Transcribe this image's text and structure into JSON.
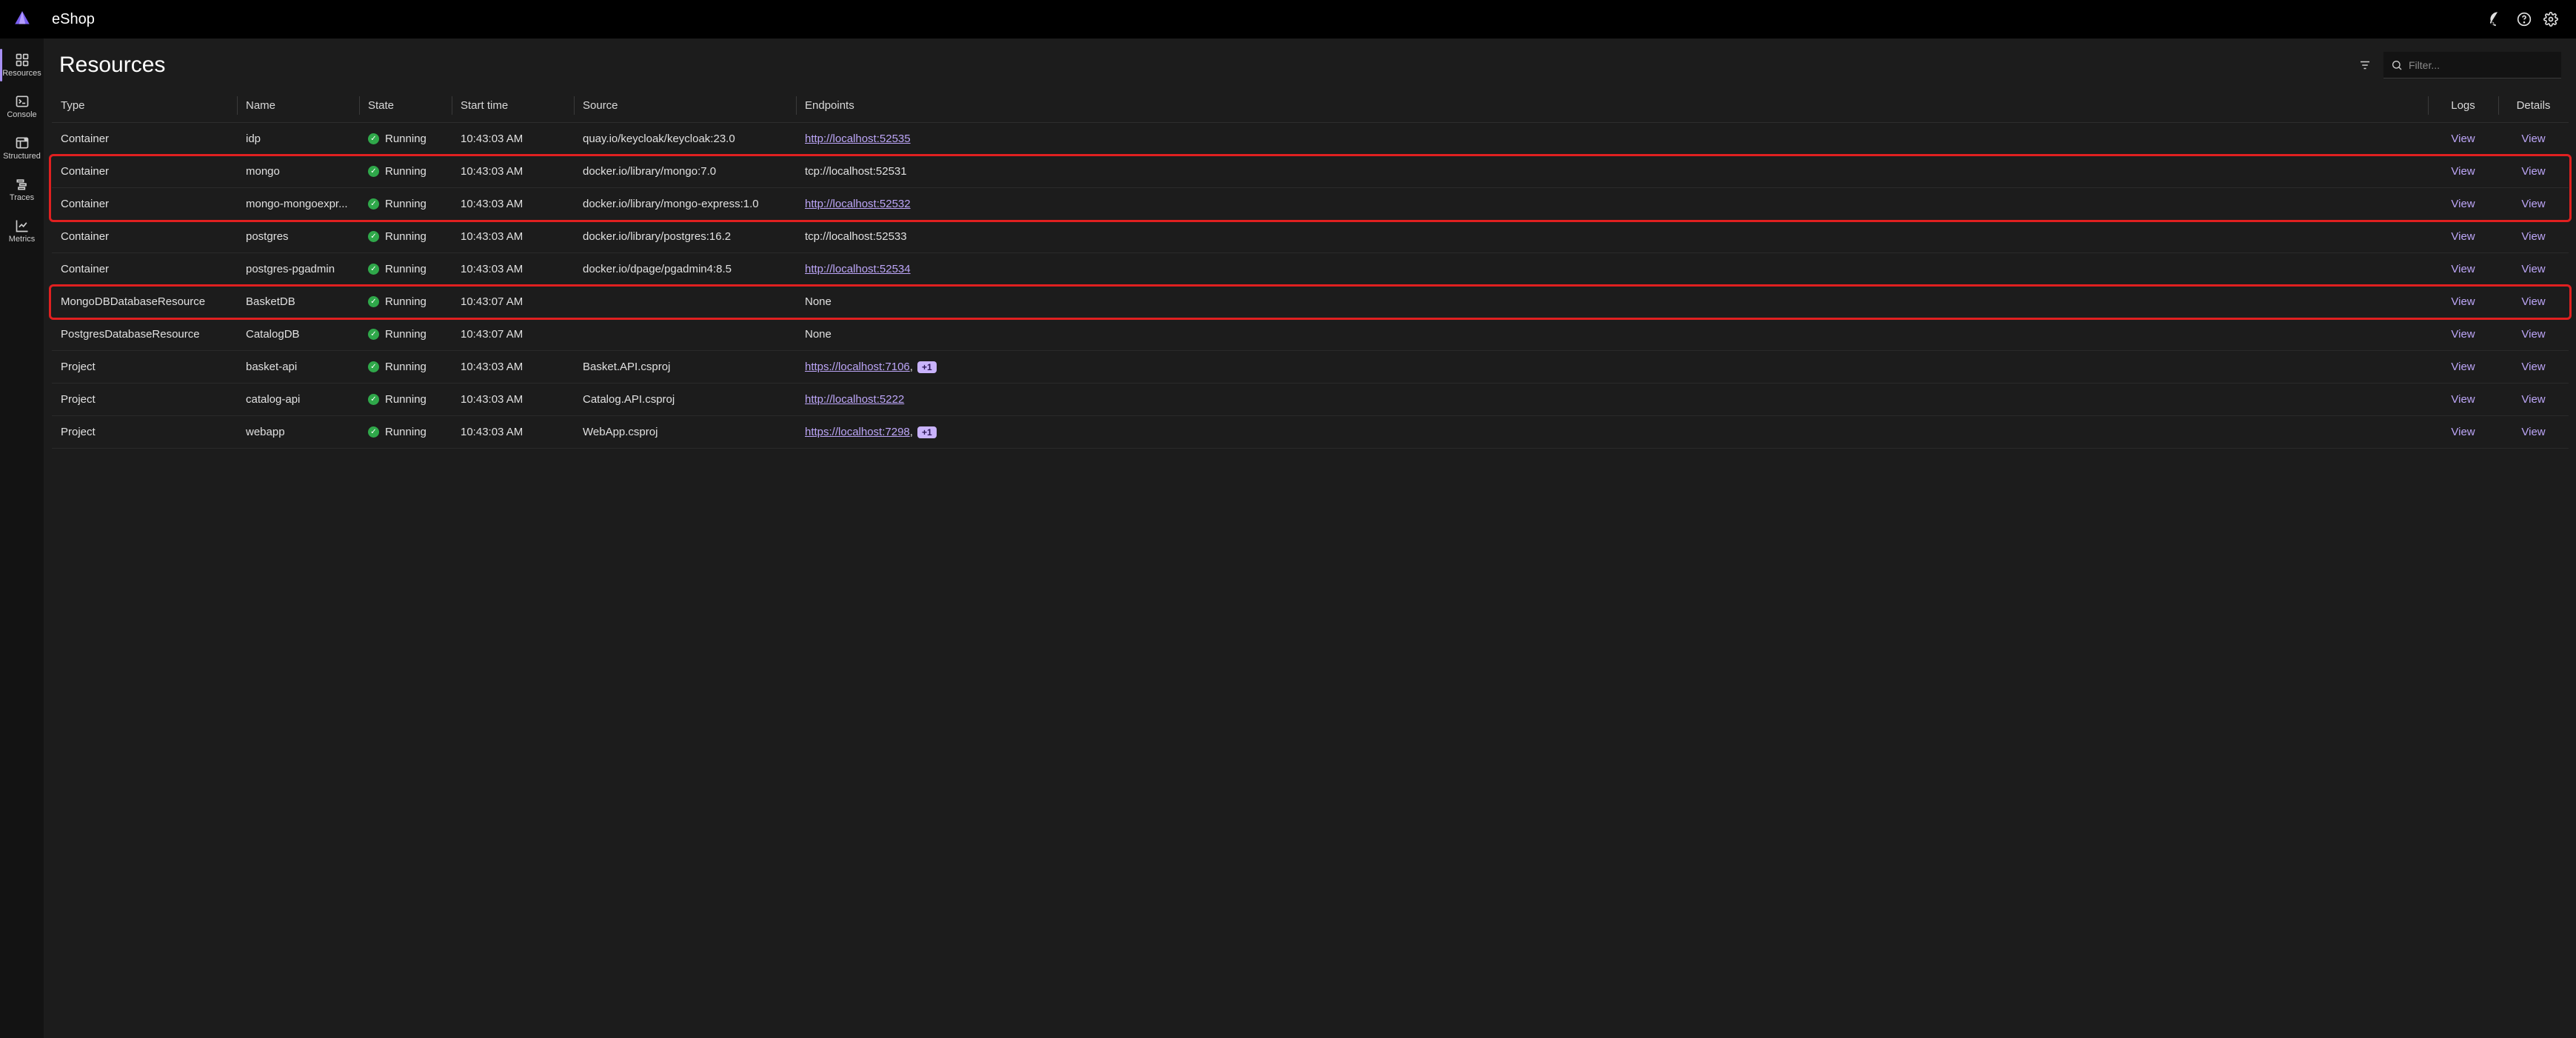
{
  "app": {
    "title": "eShop"
  },
  "top_icons": {
    "github": "github-icon",
    "help": "help-icon",
    "settings": "gear-icon"
  },
  "nav": {
    "items": [
      {
        "label": "Resources",
        "icon": "grid-icon",
        "active": true
      },
      {
        "label": "Console",
        "icon": "console-icon",
        "active": false
      },
      {
        "label": "Structured",
        "icon": "structured-icon",
        "active": false
      },
      {
        "label": "Traces",
        "icon": "traces-icon",
        "active": false
      },
      {
        "label": "Metrics",
        "icon": "metrics-icon",
        "active": false
      }
    ]
  },
  "page": {
    "title": "Resources",
    "filter_placeholder": "Filter..."
  },
  "table": {
    "headers": {
      "type": "Type",
      "name": "Name",
      "state": "State",
      "start": "Start time",
      "source": "Source",
      "endpoints": "Endpoints",
      "logs": "Logs",
      "details": "Details"
    },
    "logs_label": "View",
    "details_label": "View",
    "rows": [
      {
        "type": "Container",
        "name": "idp",
        "state": "Running",
        "start": "10:43:03 AM",
        "source": "quay.io/keycloak/keycloak:23.0",
        "endpoint": "http://localhost:52535",
        "endpoint_is_link": true,
        "extra": ""
      },
      {
        "type": "Container",
        "name": "mongo",
        "state": "Running",
        "start": "10:43:03 AM",
        "source": "docker.io/library/mongo:7.0",
        "endpoint": "tcp://localhost:52531",
        "endpoint_is_link": false,
        "extra": ""
      },
      {
        "type": "Container",
        "name": "mongo-mongoexpr...",
        "state": "Running",
        "start": "10:43:03 AM",
        "source": "docker.io/library/mongo-express:1.0",
        "endpoint": "http://localhost:52532",
        "endpoint_is_link": true,
        "extra": ""
      },
      {
        "type": "Container",
        "name": "postgres",
        "state": "Running",
        "start": "10:43:03 AM",
        "source": "docker.io/library/postgres:16.2",
        "endpoint": "tcp://localhost:52533",
        "endpoint_is_link": false,
        "extra": ""
      },
      {
        "type": "Container",
        "name": "postgres-pgadmin",
        "state": "Running",
        "start": "10:43:03 AM",
        "source": "docker.io/dpage/pgadmin4:8.5",
        "endpoint": "http://localhost:52534",
        "endpoint_is_link": true,
        "extra": ""
      },
      {
        "type": "MongoDBDatabaseResource",
        "name": "BasketDB",
        "state": "Running",
        "start": "10:43:07 AM",
        "source": "",
        "endpoint": "None",
        "endpoint_is_link": false,
        "extra": ""
      },
      {
        "type": "PostgresDatabaseResource",
        "name": "CatalogDB",
        "state": "Running",
        "start": "10:43:07 AM",
        "source": "",
        "endpoint": "None",
        "endpoint_is_link": false,
        "extra": ""
      },
      {
        "type": "Project",
        "name": "basket-api",
        "state": "Running",
        "start": "10:43:03 AM",
        "source": "Basket.API.csproj",
        "endpoint": "https://localhost:7106",
        "endpoint_is_link": true,
        "extra": "+1",
        "ep_suffix": ","
      },
      {
        "type": "Project",
        "name": "catalog-api",
        "state": "Running",
        "start": "10:43:03 AM",
        "source": "Catalog.API.csproj",
        "endpoint": "http://localhost:5222",
        "endpoint_is_link": true,
        "extra": ""
      },
      {
        "type": "Project",
        "name": "webapp",
        "state": "Running",
        "start": "10:43:03 AM",
        "source": "WebApp.csproj",
        "endpoint": "https://localhost:7298",
        "endpoint_is_link": true,
        "extra": "+1",
        "ep_suffix": ","
      }
    ]
  },
  "highlights": [
    {
      "top_row": 1,
      "bottom_row": 2
    },
    {
      "top_row": 5,
      "bottom_row": 5
    }
  ]
}
